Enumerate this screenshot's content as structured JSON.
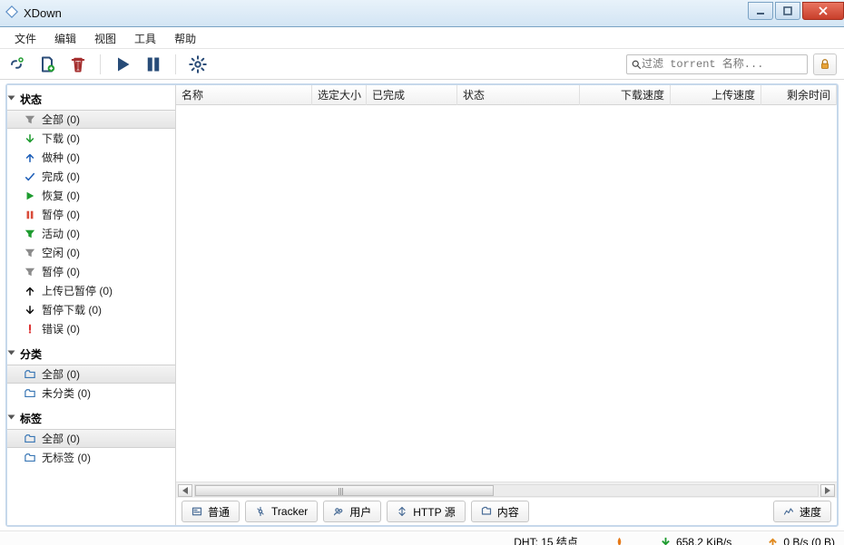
{
  "window": {
    "title": "XDown"
  },
  "menu": {
    "file": "文件",
    "edit": "编辑",
    "view": "视图",
    "tools": "工具",
    "help": "帮助"
  },
  "toolbar": {
    "search_placeholder": "过滤 torrent 名称..."
  },
  "sidebar": {
    "status_header": "状态",
    "status_items": [
      {
        "label": "全部 (0)",
        "icon": "funnel",
        "color": "#8b8b8b",
        "selected": true
      },
      {
        "label": "下载 (0)",
        "icon": "arrow-dn",
        "color": "#1e9b2f",
        "selected": false
      },
      {
        "label": "做种 (0)",
        "icon": "arrow-up",
        "color": "#1e5fb8",
        "selected": false
      },
      {
        "label": "完成 (0)",
        "icon": "check",
        "color": "#1e5fb8",
        "selected": false
      },
      {
        "label": "恢复 (0)",
        "icon": "play",
        "color": "#1e9b2f",
        "selected": false
      },
      {
        "label": "暂停 (0)",
        "icon": "pause",
        "color": "#d94b3a",
        "selected": false
      },
      {
        "label": "活动 (0)",
        "icon": "funnel",
        "color": "#1e9b2f",
        "selected": false
      },
      {
        "label": "空闲 (0)",
        "icon": "funnel",
        "color": "#8b8b8b",
        "selected": false
      },
      {
        "label": "暂停 (0)",
        "icon": "funnel",
        "color": "#8b8b8b",
        "selected": false
      },
      {
        "label": "上传已暂停 (0)",
        "icon": "arrow-up",
        "color": "#111111",
        "selected": false
      },
      {
        "label": "暂停下载 (0)",
        "icon": "arrow-dn",
        "color": "#111111",
        "selected": false
      },
      {
        "label": "错误 (0)",
        "icon": "bang",
        "color": "#d33",
        "selected": false
      }
    ],
    "category_header": "分类",
    "category_items": [
      {
        "label": "全部 (0)",
        "icon": "folder",
        "color": "#3a77b5",
        "selected": true
      },
      {
        "label": "未分类 (0)",
        "icon": "folder",
        "color": "#3a77b5",
        "selected": false
      }
    ],
    "tags_header": "标签",
    "tags_items": [
      {
        "label": "全部 (0)",
        "icon": "folder",
        "color": "#3a77b5",
        "selected": true
      },
      {
        "label": "无标签 (0)",
        "icon": "folder",
        "color": "#3a77b5",
        "selected": false
      }
    ]
  },
  "columns": {
    "name": "名称",
    "size": "选定大小",
    "done": "已完成",
    "status": "状态",
    "dlspeed": "下载速度",
    "upspeed": "上传速度",
    "eta": "剩余时间"
  },
  "detail_tabs": {
    "general": "普通",
    "tracker": "Tracker",
    "peers": "用户",
    "http": "HTTP 源",
    "content": "内容",
    "speed": "速度"
  },
  "statusbar": {
    "dht": "DHT: 15 结点",
    "down": "658.2 KiB/s",
    "up": "0 B/s (0 B)"
  }
}
